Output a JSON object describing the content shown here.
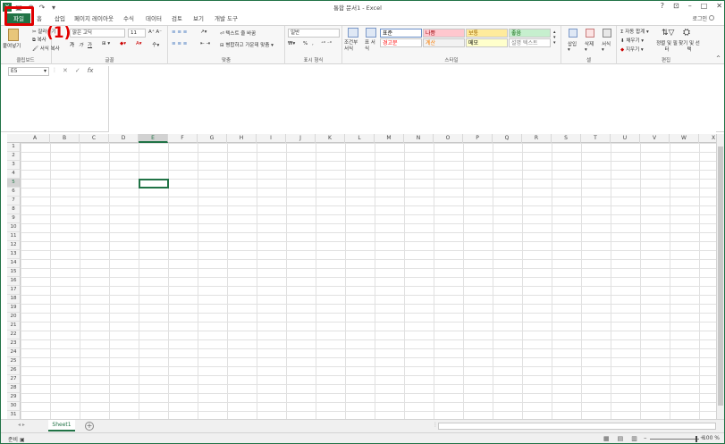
{
  "window": {
    "title": "통합 문서1 - Excel",
    "controls": [
      "?",
      "⊡",
      "–",
      "□",
      "✕"
    ],
    "sign_in": "로그인"
  },
  "tabs": [
    "파일",
    "홈",
    "삽입",
    "페이지 레이아웃",
    "수식",
    "데이터",
    "검토",
    "보기",
    "개발 도구"
  ],
  "ribbon": {
    "clipboard": {
      "label": "클립보드",
      "paste": "붙여넣기",
      "cut": "잘라내기",
      "copy": "복사",
      "format_painter": "서식 복사"
    },
    "font": {
      "label": "글꼴",
      "name": "맑은 고딕",
      "size": "11",
      "bold": "가",
      "italic": "가",
      "underline": "가"
    },
    "alignment": {
      "label": "맞춤",
      "wrap_text": "텍스트 줄 바꿈",
      "merge_center": "병합하고 가운데 맞춤"
    },
    "number": {
      "label": "표시 형식",
      "format": "일반",
      "percent": "%",
      "comma": ","
    },
    "styles": {
      "label": "스타일",
      "conditional": "조건부 서식",
      "table": "표 서식",
      "cells": [
        {
          "text": "표준",
          "bg": "#ffffff",
          "fg": "#000000"
        },
        {
          "text": "나쁨",
          "bg": "#ffc7ce",
          "fg": "#9c0006"
        },
        {
          "text": "보통",
          "bg": "#ffeb9c",
          "fg": "#9c6500"
        },
        {
          "text": "좋음",
          "bg": "#c6efce",
          "fg": "#006100"
        },
        {
          "text": "경고문",
          "bg": "#ffffff",
          "fg": "#ff0000"
        },
        {
          "text": "계산",
          "bg": "#f2f2f2",
          "fg": "#fa7d00"
        },
        {
          "text": "메모",
          "bg": "#ffffcc",
          "fg": "#000000"
        },
        {
          "text": "설명 텍스트",
          "bg": "#ffffff",
          "fg": "#7f7f7f"
        }
      ]
    },
    "cells_group": {
      "label": "셀",
      "insert": "삽입",
      "delete": "삭제",
      "format": "서식"
    },
    "editing": {
      "label": "편집",
      "autosum": "자동 합계",
      "fill": "채우기",
      "clear": "지우기",
      "sort_filter": "정렬 및 필터",
      "find_select": "찾기 및 선택"
    }
  },
  "formula_bar": {
    "name_box": "E5",
    "fx": "fx",
    "value": ""
  },
  "columns": [
    "A",
    "B",
    "C",
    "D",
    "E",
    "F",
    "G",
    "H",
    "I",
    "J",
    "K",
    "L",
    "M",
    "N",
    "O",
    "P",
    "Q",
    "R",
    "S",
    "T",
    "U",
    "V",
    "W",
    "X"
  ],
  "rows": [
    "1",
    "2",
    "3",
    "4",
    "5",
    "6",
    "7",
    "8",
    "9",
    "10",
    "11",
    "12",
    "13",
    "14",
    "15",
    "16",
    "17",
    "18",
    "19",
    "20",
    "21",
    "22",
    "23",
    "24",
    "25",
    "26",
    "27",
    "28",
    "29",
    "30",
    "31"
  ],
  "selected": {
    "col": "E",
    "row": "5"
  },
  "sheets": [
    "Sheet1"
  ],
  "status": {
    "text": "준비",
    "zoom": "100 %"
  },
  "annotation": {
    "label": "(1)",
    "color": "#e00000"
  }
}
